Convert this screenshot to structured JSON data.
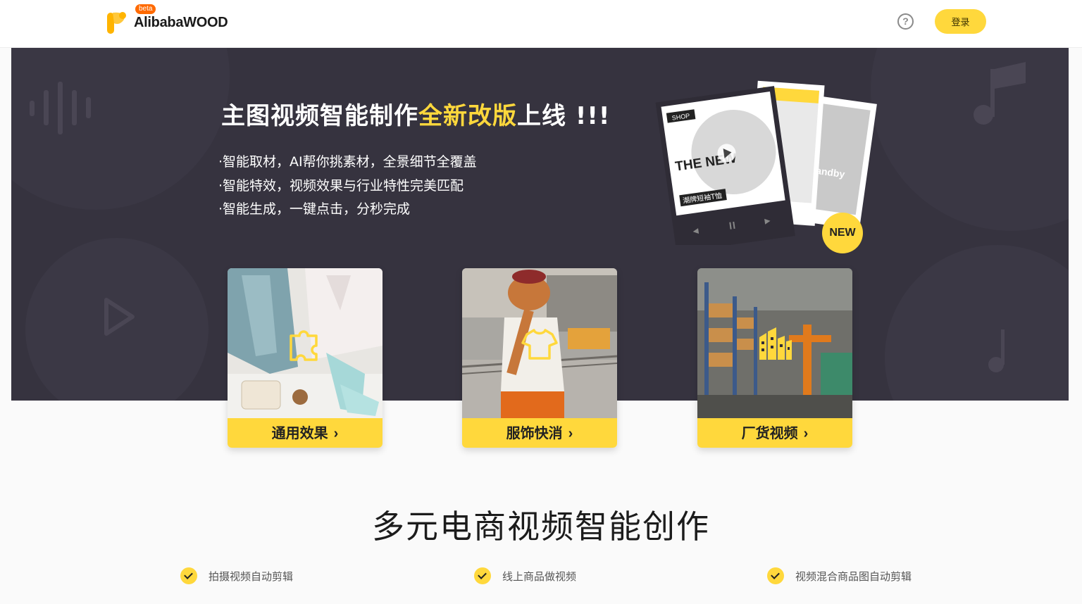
{
  "header": {
    "logo_text": "AlibabaWOOD",
    "beta": "beta",
    "help_icon": "question-circle-icon",
    "login_label": "登录"
  },
  "banner": {
    "headline_part1": "主图视频智能制作",
    "headline_highlight": "全新改版",
    "headline_part2": "上线 !!!",
    "bullets": [
      "·智能取材，AI帮你挑素材，全景细节全覆盖",
      "·智能特效，视频效果与行业特性完美匹配",
      "·智能生成，一键点击，分秒完成"
    ],
    "promo": {
      "shop_tag": "SHOP",
      "the_new": "THE NEW",
      "caption": "潮牌短袖T恤",
      "side_text": "standby",
      "new_badge": "NEW"
    }
  },
  "categories": [
    {
      "label": "通用效果",
      "icon": "puzzle-piece-icon"
    },
    {
      "label": "服饰快消",
      "icon": "tshirt-icon"
    },
    {
      "label": "厂货视频",
      "icon": "factory-buildings-icon"
    }
  ],
  "section": {
    "title": "多元电商视频智能创作",
    "features": [
      "拍摄视频自动剪辑",
      "线上商品做视频",
      "视频混合商品图自动剪辑"
    ]
  },
  "colors": {
    "accent": "#ffd83c",
    "banner_bg": "#36333f",
    "beta_badge": "#ff6a00"
  }
}
